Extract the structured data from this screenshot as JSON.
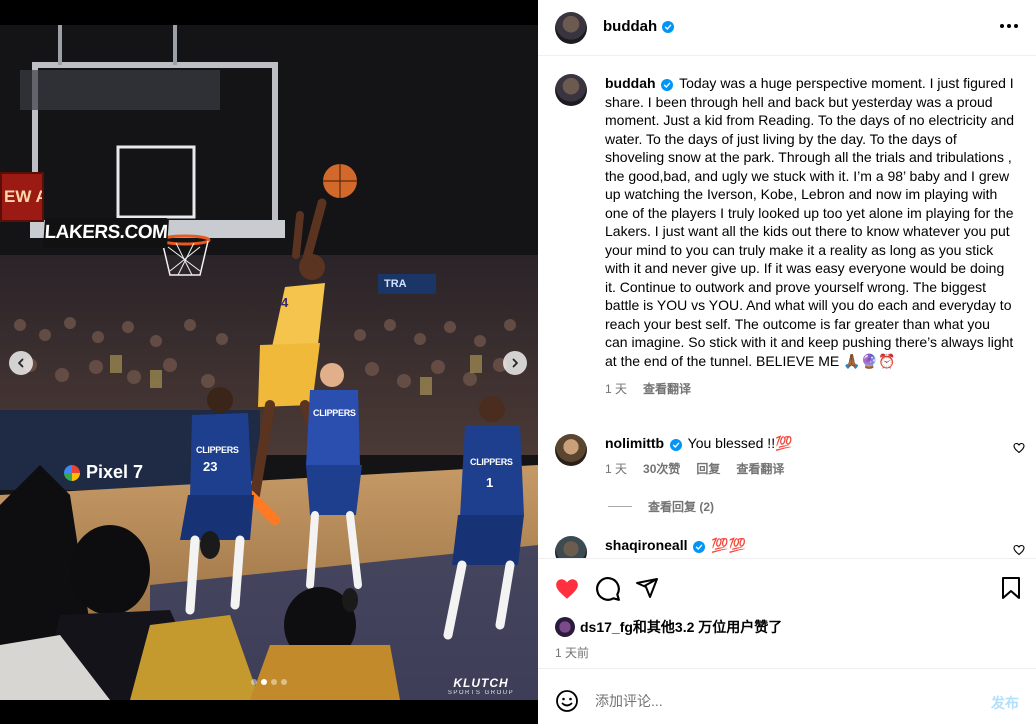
{
  "media": {
    "image_description_icons": "basketball-photo",
    "signs": {
      "lakers": "LAKERS.COM",
      "view": "EW AP",
      "pixel": "Pixel 7",
      "tra": "TRA"
    },
    "jersey": {
      "player_main_number": "4",
      "clippers_label": "CLIPPERS",
      "number_23": "23",
      "number_1": "1"
    },
    "brand": {
      "line1": "KLUTCH",
      "line2": "SPORTS GROUP"
    },
    "carousel": {
      "count": 4,
      "active_index": 1
    }
  },
  "header": {
    "username": "buddah",
    "verified": true,
    "more_icon": "more-horizontal-icon"
  },
  "caption": {
    "username": "buddah",
    "text": "Today was a huge perspective moment. I just figured I share. I been through hell and back but yesterday was a proud moment. Just a kid from Reading. To the days of no electricity and water. To the days of just living by the day. To the days of shoveling snow at the park. Through all the trials and tribulations , the good,bad, and ugly we stuck with it. I’m a 98’ baby and I grew up watching the Iverson, Kobe, Lebron and now im playing with one of the players I truly looked up too yet alone im playing for the Lakers. I just want all the kids out there to know whatever you put your mind to you can truly make it a reality as long as you stick with it and never give up. If it was easy everyone would be doing it. Continue to outwork and prove yourself wrong. The biggest battle is YOU vs YOU. And what will you do each and everyday to reach your best self. The outcome is far greater than what you can imagine. So stick with it and keep pushing there’s always light at the end of the tunnel. BELIEVE ME 🙏🏾🔮⏰",
    "time": "1 天",
    "translate": "查看翻译"
  },
  "comments": [
    {
      "username": "nolimittb",
      "text": "You blessed !!💯",
      "time": "1 天",
      "likes": "30次赞",
      "reply": "回复",
      "translate": "查看翻译"
    },
    {
      "username": "shaqironeall",
      "text": "💯💯"
    }
  ],
  "view_replies": "查看回复 (2)",
  "actions": {
    "like_icon": "heart-filled-icon",
    "comment_icon": "comment-icon",
    "share_icon": "share-icon",
    "save_icon": "bookmark-icon",
    "liked_color": "#ff3040"
  },
  "likes": {
    "user": "ds17_fg",
    "rest": "和其他3.2 万位用户赞了"
  },
  "posted_time": "1 天前",
  "add_comment": {
    "placeholder": "添加评论...",
    "post_label": "发布"
  }
}
